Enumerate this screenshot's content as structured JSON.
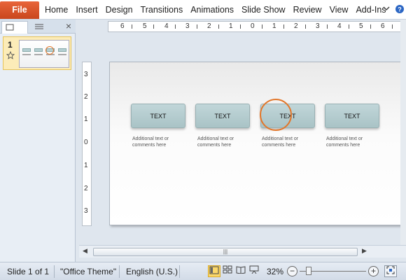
{
  "ribbon": {
    "file_label": "File",
    "tabs": [
      "Home",
      "Insert",
      "Design",
      "Transitions",
      "Animations",
      "Slide Show",
      "Review",
      "View",
      "Add-Ins"
    ],
    "help_icon": "help-icon",
    "minimize_icon": "chevron-down-icon"
  },
  "left_pane": {
    "tabs": [
      "slides-tab",
      "outline-tab"
    ],
    "close_label": "×",
    "slide_number": "1",
    "transition_icon": "star-icon"
  },
  "rulers": {
    "horizontal_ticks": [
      "6",
      "5",
      "4",
      "3",
      "2",
      "1",
      "0",
      "1",
      "2",
      "3",
      "4",
      "5",
      "6"
    ],
    "vertical_ticks": [
      "3",
      "2",
      "1",
      "0",
      "1",
      "2",
      "3"
    ]
  },
  "slide": {
    "boxes": [
      {
        "label": "TEXT",
        "description": "Additional text or comments here"
      },
      {
        "label": "TEXT",
        "description": "Additional text or comments here"
      },
      {
        "label": "TEXT",
        "description": "Additional text or comments here"
      },
      {
        "label": "TEXT",
        "description": "Additional text or comments here"
      }
    ],
    "highlight_color": "#e2772b",
    "box_color": "#b5cfd3"
  },
  "status": {
    "slide_info": "Slide 1 of 1",
    "theme": "\"Office Theme\"",
    "language": "English (U.S.)",
    "zoom": "32%",
    "zoom_out": "−",
    "zoom_in": "+"
  }
}
